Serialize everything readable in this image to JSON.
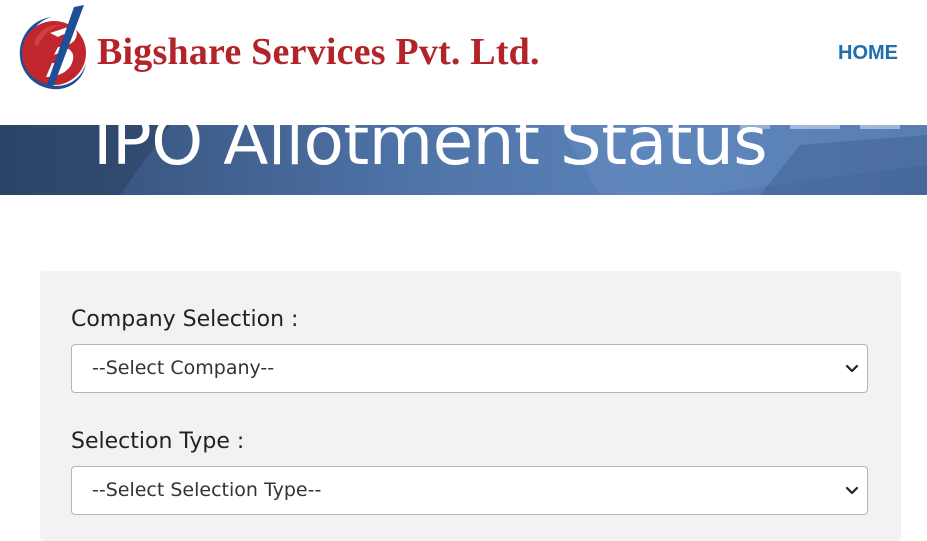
{
  "header": {
    "brand_name": "Bigshare Services Pvt. Ltd.",
    "logo_icon": "bigshare-b-logo",
    "nav": {
      "home_label": "HOME"
    }
  },
  "banner": {
    "title": "IPO Allotment Status"
  },
  "form": {
    "company_selection": {
      "label": "Company Selection :",
      "selected_value": "--Select Company--",
      "icon": "chevron-down-icon"
    },
    "selection_type": {
      "label": "Selection Type :",
      "selected_value": "--Select Selection Type--",
      "icon": "chevron-down-icon"
    }
  },
  "colors": {
    "brand_red": "#b3242a",
    "brand_blue": "#1d5fa8",
    "nav_link": "#1e6fb0",
    "banner_blue": "#4f74a8",
    "panel_bg": "#f2f2f2"
  }
}
